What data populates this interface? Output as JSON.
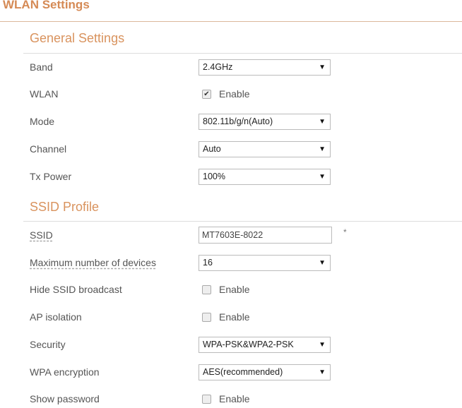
{
  "title": "WLAN Settings",
  "general": {
    "heading": "General Settings",
    "band": {
      "label": "Band",
      "value": "2.4GHz"
    },
    "wlan": {
      "label": "WLAN",
      "checkbox_label": "Enable",
      "checked": true,
      "check_mark": "✔"
    },
    "mode": {
      "label": "Mode",
      "value": "802.11b/g/n(Auto)"
    },
    "channel": {
      "label": "Channel",
      "value": "Auto"
    },
    "tx_power": {
      "label": "Tx Power",
      "value": "100%"
    }
  },
  "ssid_profile": {
    "heading": "SSID Profile",
    "ssid": {
      "label": "SSID",
      "value": "MT7603E-8022",
      "required": "*"
    },
    "max_devices": {
      "label": "Maximum number of devices",
      "value": "16"
    },
    "hide_ssid": {
      "label": "Hide SSID broadcast",
      "checkbox_label": "Enable",
      "checked": false
    },
    "ap_isolation": {
      "label": "AP isolation",
      "checkbox_label": "Enable",
      "checked": false
    },
    "security": {
      "label": "Security",
      "value": "WPA-PSK&WPA2-PSK"
    },
    "wpa_encryption": {
      "label": "WPA encryption",
      "value": "AES(recommended)"
    },
    "show_password": {
      "label": "Show password",
      "checkbox_label": "Enable",
      "checked": false
    }
  },
  "dropdown_arrow": "▼"
}
